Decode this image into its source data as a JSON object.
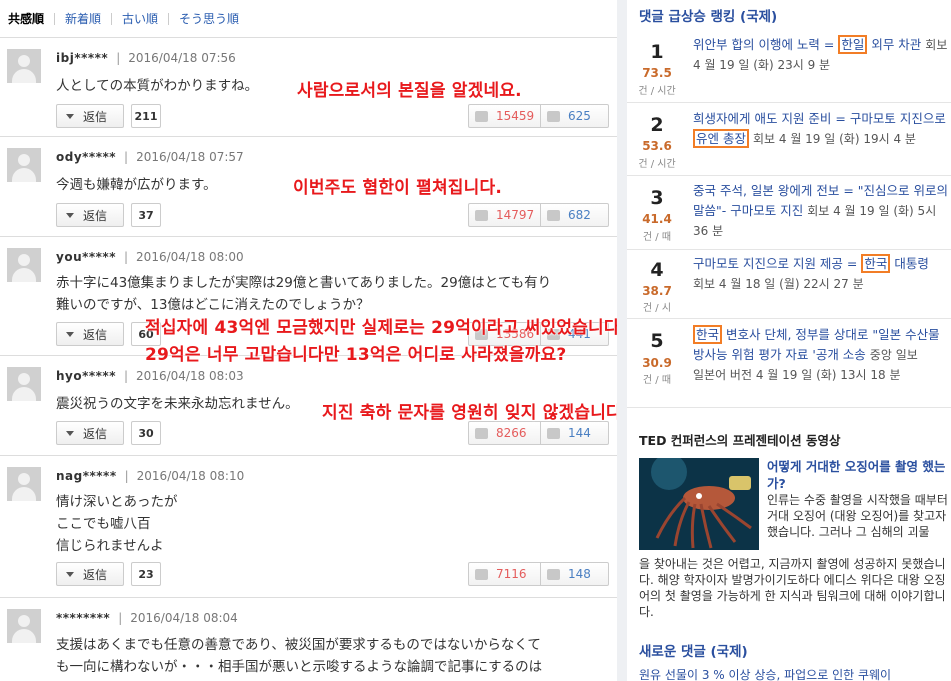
{
  "sort": [
    "共感順",
    "新着順",
    "古い順",
    "そう思う順"
  ],
  "comments": [
    {
      "user": "ibj*****",
      "date": "2016/04/18 07:56",
      "lines": [
        "人としての本質がわかりますね。"
      ],
      "reply_label": "返信",
      "replies": "211",
      "up": "15459",
      "down": "625"
    },
    {
      "user": "ody*****",
      "date": "2016/04/18 07:57",
      "lines": [
        "今週も嫌韓が広がります。"
      ],
      "reply_label": "返信",
      "replies": "37",
      "up": "14797",
      "down": "682"
    },
    {
      "user": "you*****",
      "date": "2016/04/18 08:00",
      "lines": [
        "赤十字に43億集まりましたが実際は29億と書いてありました。29億はとても有り",
        "難いのですが、13億はどこに消えたのでしょうか？"
      ],
      "reply_label": "返信",
      "replies": "60",
      "up": "13586",
      "down": "441"
    },
    {
      "user": "hyo*****",
      "date": "2016/04/18 08:03",
      "lines": [
        "震災祝うの文字を未来永劫忘れません。"
      ],
      "reply_label": "返信",
      "replies": "30",
      "up": "8266",
      "down": "144"
    },
    {
      "user": "nag*****",
      "date": "2016/04/18 08:10",
      "lines": [
        "情け深いとあったが",
        "ここでも嘘八百",
        "信じられませんよ"
      ],
      "reply_label": "返信",
      "replies": "23",
      "up": "7116",
      "down": "148"
    },
    {
      "user": "********",
      "date": "2016/04/18 08:04",
      "lines": [
        "支援はあくまでも任意の善意であり、被災国が要求するものではないからなくて",
        "も一向に構わないが・・・相手国が悪いと示唆するような論調で記事にするのは"
      ]
    }
  ],
  "annotations": [
    "사람으로서의 본질을 알겠네요.",
    "이번주도 혐한이 펼쳐집니다.",
    "적십자에 43억엔 모금했지만 실제로는 29억이라고 써있었습니다.",
    "29억은 너무 고맙습니다만 13억은 어디로 사라졌을까요?",
    "지진 축하 문자를 영원히 잊지 않겠습니다."
  ],
  "sidebar": {
    "ranking_title": "댓글 급상승 랭킹 (국제)",
    "rank_items": [
      {
        "num": "1",
        "score": "73.5",
        "unit": "건 / 시간",
        "pre": "위안부 합의 이행에 노력 = ",
        "hl": "한일",
        "post": " 외무 차관",
        "src": "회보  4 월 19 일 (화) 23시 9 분"
      },
      {
        "num": "2",
        "score": "53.6",
        "unit": "건 / 시간",
        "pre": "희생자에게 애도 지원 준비 = 구마모토 지진으로 ",
        "hl": "유엔 총장",
        "post": "",
        "src": "회보  4 월 19 일 (화) 19시 4 분"
      },
      {
        "num": "3",
        "score": "41.4",
        "unit": "건 / 때",
        "pre": "중국 주석, 일본 왕에게 전보 = \"진심으로 위로의 말씀\"- 구마모토 지진",
        "hl": "",
        "post": "",
        "src": "회보  4 월 19 일 (화) 5시 36 분"
      },
      {
        "num": "4",
        "score": "38.7",
        "unit": "건 / 시",
        "pre": "구마모토 지진으로 지원 제공 = ",
        "hl": "한국",
        "post": " 대통령",
        "src": "회보  4 월 18 일 (월) 22시 27 분"
      },
      {
        "num": "5",
        "score": "30.9",
        "unit": "건 / 때",
        "pre": "",
        "hl": "한국",
        "post": " 변호사 단체, 정부를 상대로 \"일본 수산물 방사능 위험 평가 자료 '공개 소송",
        "src": "중앙 일보 일본어 버전  4 월 19 일 (화) 13시 18 분"
      }
    ],
    "ted_title": "TED 컨퍼런스의 프레젠테이션 동영상",
    "ted_headline": "어떻게 거대한 오징어를 촬영 했는가?",
    "ted_body_side": "인류는 수중 촬영을 시작했을 때부터 거대 오징어 (대왕 오징어)를 찾고자했습니다. 그러나 그 심해의 괴물",
    "ted_body_full": "을 찾아내는 것은 어렵고, 지금까지 촬영에 성공하지 못했습니다. 해양 학자이자 발명가이기도하다 에디스 위다은 대왕 오징어의 첫 촬영을 가능하게 한 지식과 팀워크에 대해 이야기합니다.",
    "new_comments_title": "새로운 댓글 (국제)",
    "new_comment_line": "원유 선물이 3 % 이상 상승, 파업으로 인한 쿠웨이"
  },
  "colors": {
    "link": "#2a4f9f",
    "annotation": "#e8191c",
    "highlight_box": "#f27d26",
    "up_vote": "#e45c5c",
    "down_vote": "#4a7fc2",
    "score": "#c96a2b"
  }
}
